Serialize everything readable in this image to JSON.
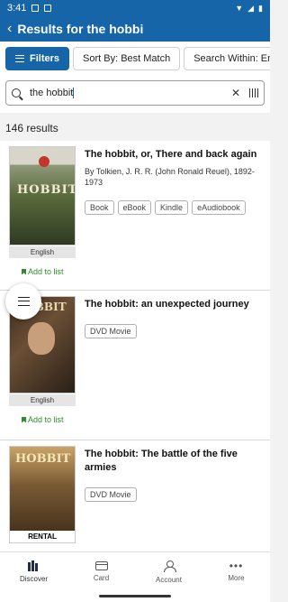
{
  "status": {
    "time": "3:41"
  },
  "header": {
    "title": "Results for the hobbi"
  },
  "filters": {
    "filters_label": "Filters",
    "sort_label": "Sort By: Best Match",
    "search_within_label": "Search Within: Ent"
  },
  "search": {
    "value": "the hobbit"
  },
  "results_count": "146 results",
  "results": [
    {
      "title": "The hobbit, or, There and back again",
      "author": "By Tolkien, J. R. R. (John Ronald Reuel), 1892-1973",
      "formats": [
        "Book",
        "eBook",
        "Kindle",
        "eAudiobook"
      ],
      "language": "English",
      "add_label": "Add to list",
      "cover_text": "HOBBIT"
    },
    {
      "title": "The hobbit: an unexpected journey",
      "formats": [
        "DVD Movie"
      ],
      "language": "English",
      "add_label": "Add to list",
      "cover_text": "HOBBIT"
    },
    {
      "title": "The hobbit: The battle of the five armies",
      "formats": [
        "DVD Movie"
      ],
      "cover_text": "HOBBIT",
      "cover_badge": "RENTAL"
    }
  ],
  "bottom_nav": [
    {
      "label": "Discover",
      "icon": "discover-icon",
      "active": true
    },
    {
      "label": "Card",
      "icon": "card-icon"
    },
    {
      "label": "Account",
      "icon": "account-icon"
    },
    {
      "label": "More",
      "icon": "more-icon"
    }
  ],
  "colors": {
    "brand": "#1565a8",
    "add_list": "#2e8b2e"
  }
}
